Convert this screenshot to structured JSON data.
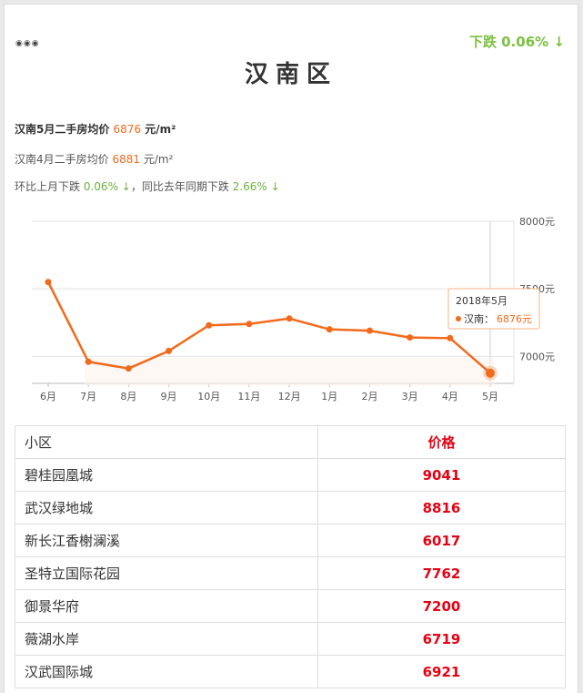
{
  "header": {
    "dots": "◉◉◉",
    "trend": "下跌 0.06% ↓",
    "title": "汉南区"
  },
  "info": {
    "line1_prefix": "汉南5月二手房均价",
    "line1_value": "6876",
    "line1_unit": "元/m²",
    "line2_prefix": "汉南4月二手房均价",
    "line2_value": "6881",
    "line2_unit": "元/m²",
    "line3_a": "环比上月下跌",
    "line3_b": "0.06% ↓",
    "line3_c": "，同比去年同期下跌",
    "line3_d": "2.66% ↓"
  },
  "chart_data": {
    "type": "line",
    "categories": [
      "6月",
      "7月",
      "8月",
      "9月",
      "10月",
      "11月",
      "12月",
      "1月",
      "2月",
      "3月",
      "4月",
      "5月"
    ],
    "series": [
      {
        "values": [
          7550,
          6960,
          6910,
          7040,
          7230,
          7240,
          7280,
          7200,
          7190,
          7140,
          7135,
          6876
        ]
      }
    ],
    "y_tick_labels": [
      "8000元",
      "7500元",
      "7000元"
    ],
    "ylim": [
      6800,
      8000
    ],
    "grid": true,
    "line_color": "#f26a1b",
    "tooltip": {
      "title": "2018年5月",
      "label": "汉南：",
      "value": "6876元"
    }
  },
  "table": {
    "headers": [
      "小区",
      "价格"
    ],
    "rows": [
      {
        "name": "碧桂园凰城",
        "price": "9041"
      },
      {
        "name": "武汉绿地城",
        "price": "8816"
      },
      {
        "name": "新长江香榭澜溪",
        "price": "6017"
      },
      {
        "name": "圣特立国际花园",
        "price": "7762"
      },
      {
        "name": "御景华府",
        "price": "7200"
      },
      {
        "name": "薇湖水岸",
        "price": "6719"
      },
      {
        "name": "汉武国际城",
        "price": "6921"
      }
    ]
  }
}
